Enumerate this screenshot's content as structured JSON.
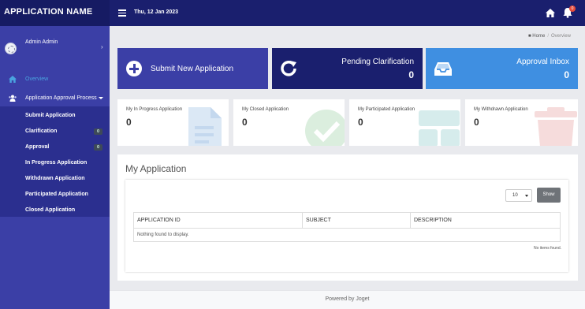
{
  "header": {
    "app_name": "APPLICATION NAME",
    "date": "Thu, 12 Jan 2023",
    "notification_count": "0"
  },
  "sidebar": {
    "user_name": "Admin Admin",
    "items": [
      {
        "label": "Overview",
        "icon": "dashboard-icon"
      },
      {
        "label": "Application Approval Process",
        "icon": "users-icon"
      }
    ],
    "submenu": [
      {
        "label": "Submit Application"
      },
      {
        "label": "Clarification",
        "count": "0"
      },
      {
        "label": "Approval",
        "count": "0"
      },
      {
        "label": "In Progress Application"
      },
      {
        "label": "Withdrawn Application"
      },
      {
        "label": "Participated Application"
      },
      {
        "label": "Closed Application"
      }
    ]
  },
  "breadcrumb": {
    "home": "Home",
    "current": "Overview"
  },
  "tiles": {
    "submit": {
      "label": "Submit New Application"
    },
    "pending": {
      "title": "Pending Clarification",
      "value": "0"
    },
    "inbox": {
      "title": "Approval Inbox",
      "value": "0"
    }
  },
  "stats": [
    {
      "label": "My In Progress Application",
      "value": "0"
    },
    {
      "label": "My Closed Application",
      "value": "0"
    },
    {
      "label": "My Participated Application",
      "value": "0"
    },
    {
      "label": "My Withdrawn Application",
      "value": "0"
    }
  ],
  "my_application": {
    "title": "My Application",
    "page_size": "10",
    "show_label": "Show",
    "columns": [
      "APPLICATION ID",
      "SUBJECT",
      "DESCRIPTION"
    ],
    "empty_message": "Nothing found to display.",
    "no_items": "No items found."
  },
  "footer": {
    "text": "Powered by Joget"
  },
  "colors": {
    "header": "#1a1f6e",
    "sidebar": "#3b3fa6",
    "accent_blue": "#3f8fe1",
    "overview_active": "#4aa3df"
  }
}
